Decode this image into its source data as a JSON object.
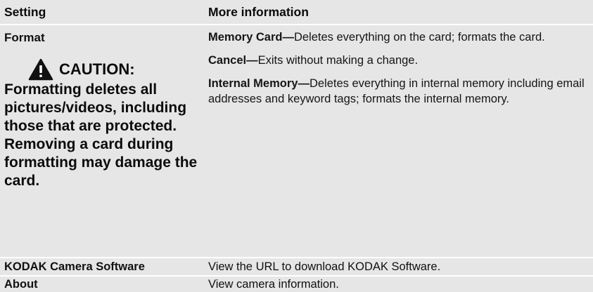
{
  "header": {
    "setting": "Setting",
    "more_information": "More information"
  },
  "format": {
    "name": "Format",
    "caution_label": "CAUTION:",
    "caution_icon": "warning-triangle-icon",
    "caution_text": "Formatting deletes all pictures/videos, including those that are protected. Removing a card during formatting may damage the card.",
    "options": [
      {
        "name": "Memory Card—",
        "description": "Deletes everything on the card; formats the card."
      },
      {
        "name": "Cancel—",
        "description": "Exits without making a change."
      },
      {
        "name": "Internal Memory—",
        "description": "Deletes everything in internal memory including email addresses and keyword tags; formats the internal memory."
      }
    ]
  },
  "software": {
    "name": "KODAK Camera Software",
    "info": "View the URL to download KODAK Software."
  },
  "about": {
    "name": "About",
    "info": "View camera information."
  }
}
